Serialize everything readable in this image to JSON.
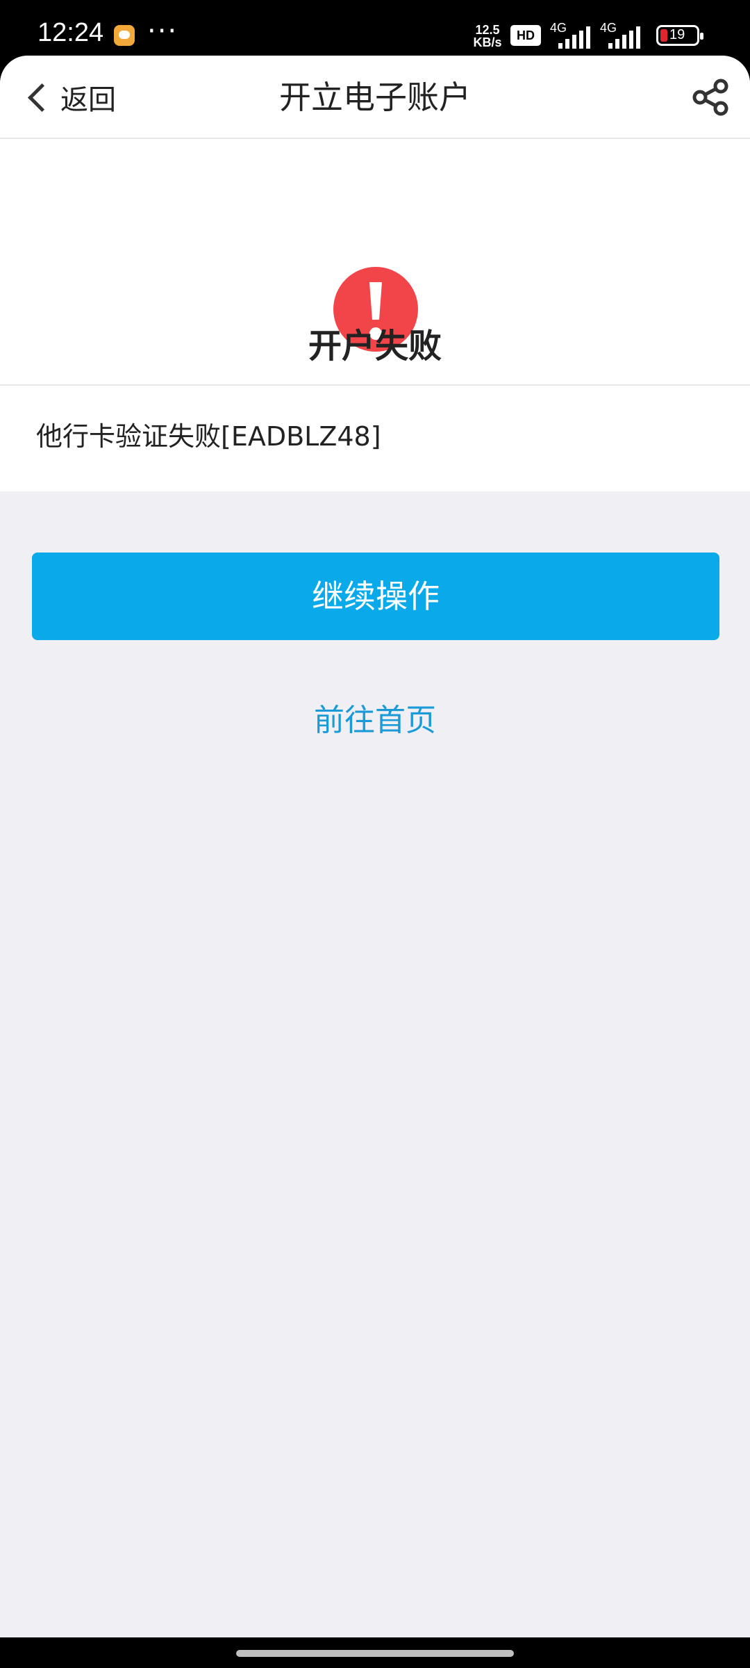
{
  "status_bar": {
    "time": "12:24",
    "dots": "···",
    "speed_value": "12.5",
    "speed_unit": "KB/s",
    "hd_label": "HD",
    "network_1": "4G",
    "network_2": "4G",
    "battery_level": "19"
  },
  "nav": {
    "back_label": "返回",
    "title": "开立电子账户"
  },
  "result": {
    "title": "开户失败",
    "message": "他行卡验证失败[EADBLZ48]"
  },
  "actions": {
    "continue_label": "继续操作",
    "home_label": "前往首页"
  },
  "colors": {
    "accent": "#0aa9ea",
    "link": "#1a9ad6",
    "error": "#f2454a",
    "background": "#efeff4"
  }
}
